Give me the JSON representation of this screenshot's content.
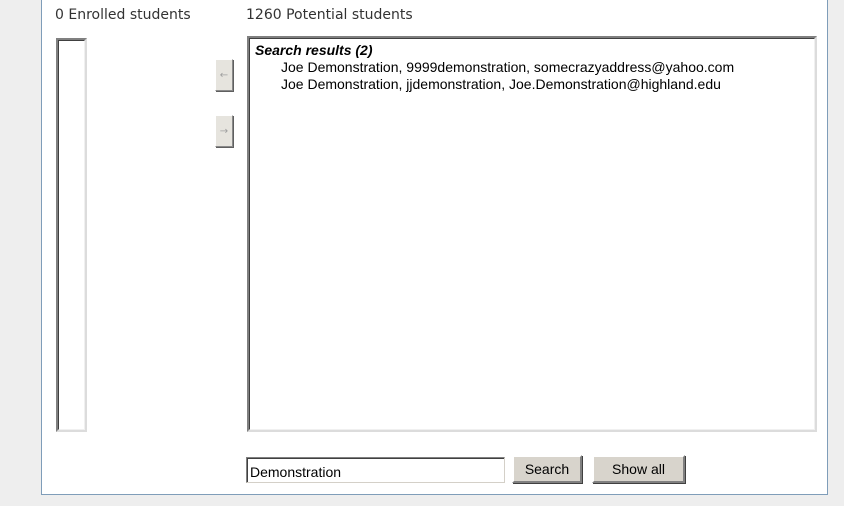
{
  "enrolled": {
    "heading": "0 Enrolled students"
  },
  "potential": {
    "heading": "1260 Potential students",
    "group_label": "Search results (2)",
    "results": [
      "Joe Demonstration, 9999demonstration, somecrazyaddress@yahoo.com",
      "Joe Demonstration, jjdemonstration, Joe.Demonstration@highland.edu"
    ]
  },
  "transfer": {
    "add_icon": "left-arrow-icon",
    "add_glyph": "←",
    "remove_icon": "right-arrow-icon",
    "remove_glyph": "→"
  },
  "search": {
    "value": "Demonstration",
    "search_label": "Search",
    "show_all_label": "Show all"
  }
}
